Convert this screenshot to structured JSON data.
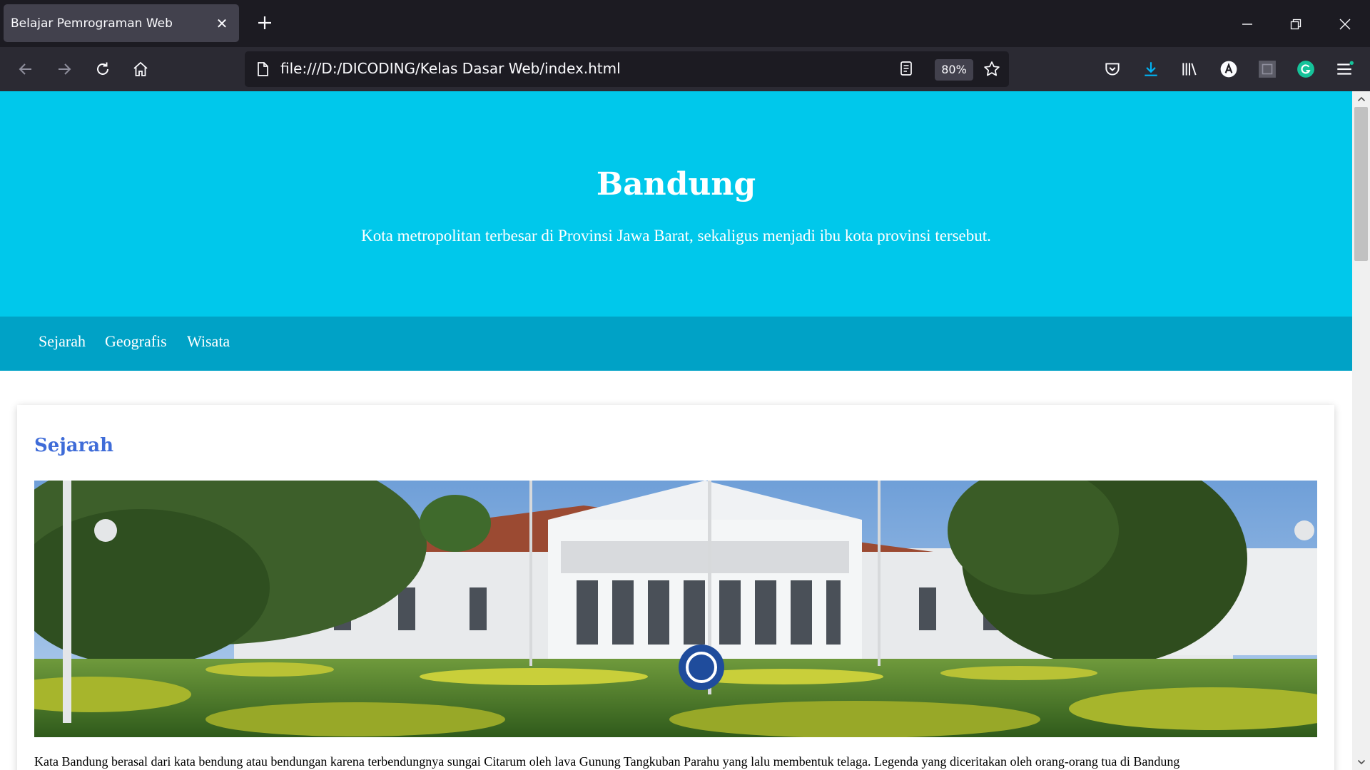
{
  "browser": {
    "tab": {
      "title": "Belajar Pemrograman Web",
      "close_icon": "close-icon"
    },
    "url": "file:///D:/DICODING/Kelas Dasar Web/index.html",
    "zoom": "80%",
    "colors": {
      "frame": "#1c1b22",
      "toolbar": "#2b2a33",
      "tab_active": "#42414d",
      "download_accent": "#00b3f4",
      "grammarly": "#15c39a"
    }
  },
  "page": {
    "header": {
      "title": "Bandung",
      "tagline": "Kota metropolitan terbesar di Provinsi Jawa Barat, sekaligus menjadi ibu kota provinsi tersebut."
    },
    "nav": {
      "items": [
        "Sejarah",
        "Geografis",
        "Wisata"
      ]
    },
    "article": {
      "heading": "Sejarah",
      "image": "photo of Gedung Sate / Bandung government building with lawn",
      "text": "Kata Bandung berasal dari kata bendung atau bendungan karena terbendungnya sungai Citarum oleh lava Gunung Tangkuban Parahu yang lalu membentuk telaga. Legenda yang diceritakan oleh orang-orang tua di Bandung"
    },
    "colors": {
      "header_bg": "#00c8eb",
      "nav_bg": "#00a2c6",
      "heading": "#3f6cd8"
    }
  }
}
